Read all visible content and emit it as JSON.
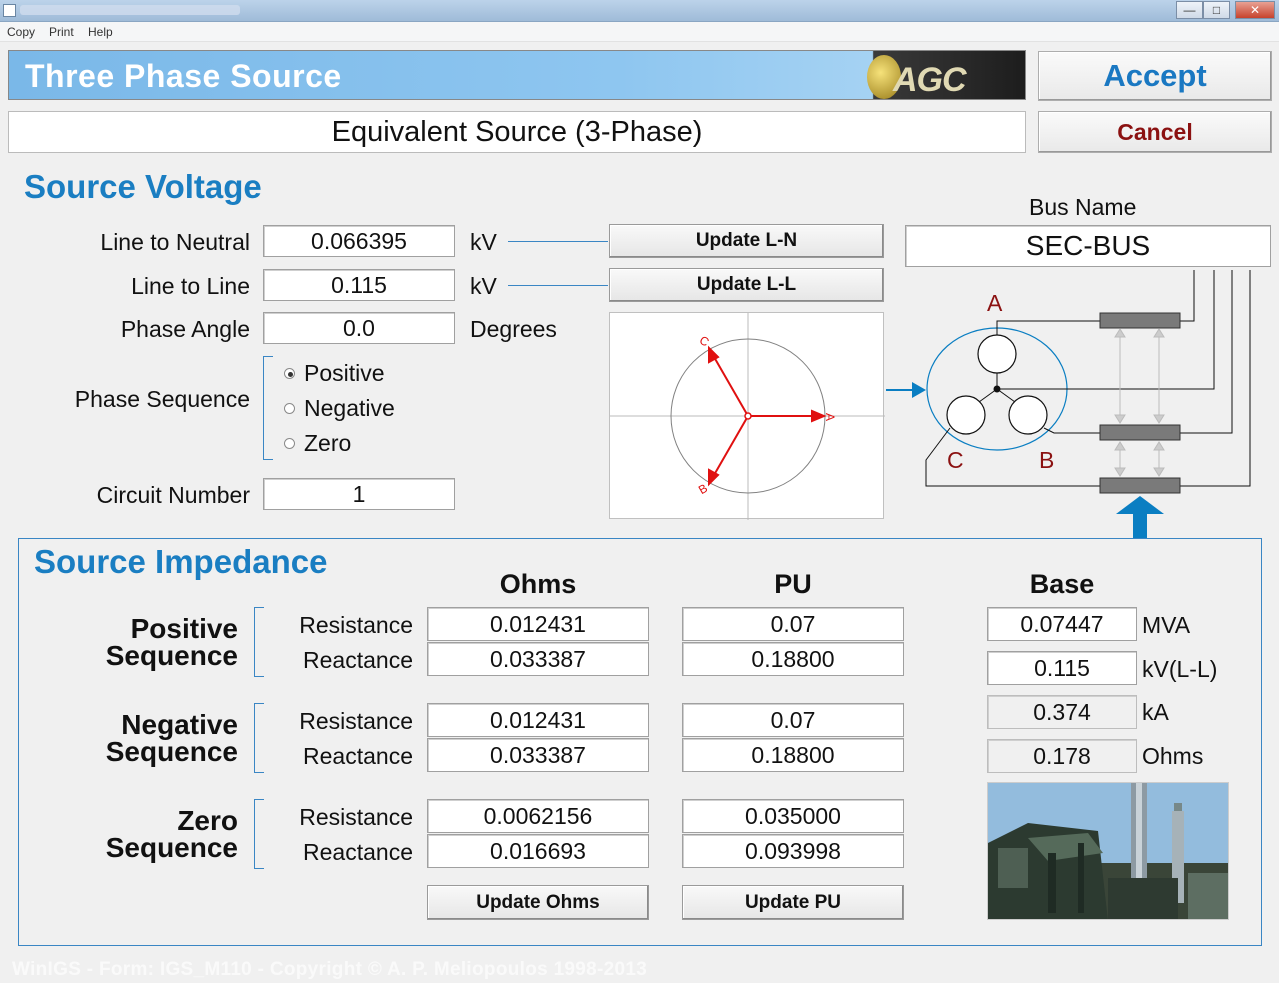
{
  "window": {
    "minimize": "—",
    "maximize": "□",
    "close": "✕"
  },
  "menu": {
    "items": [
      "Copy",
      "Print",
      "Help"
    ]
  },
  "header": {
    "title": "Three Phase Source",
    "logo_text": "AGC",
    "subtitle": "Equivalent Source (3-Phase)",
    "accept_label": "Accept",
    "cancel_label": "Cancel"
  },
  "source_voltage": {
    "title": "Source Voltage",
    "line_to_neutral": {
      "label": "Line to Neutral",
      "value": "0.066395",
      "unit": "kV"
    },
    "line_to_line": {
      "label": "Line to Line",
      "value": "0.115",
      "unit": "kV"
    },
    "phase_angle": {
      "label": "Phase Angle",
      "value": "0.0",
      "unit": "Degrees"
    },
    "phase_sequence": {
      "label": "Phase Sequence",
      "options": [
        "Positive",
        "Negative",
        "Zero"
      ],
      "selected": "Positive"
    },
    "circuit_number": {
      "label": "Circuit Number",
      "value": "1"
    },
    "update_ln_label": "Update L-N",
    "update_ll_label": "Update L-L"
  },
  "phasor": {
    "labels": [
      "A",
      "B",
      "C"
    ],
    "colors": {
      "phasor": "#e01010",
      "circle": "#808080"
    }
  },
  "bus": {
    "label": "Bus Name",
    "value": "SEC-BUS"
  },
  "schematic": {
    "phase_labels": [
      "A",
      "B",
      "C"
    ],
    "colors": {
      "label": "#8b1111",
      "accent": "#0a7ec2"
    }
  },
  "source_impedance": {
    "title": "Source Impedance",
    "columns": [
      "Ohms",
      "PU",
      "Base"
    ],
    "sequences": [
      {
        "name_line1": "Positive",
        "name_line2": "Sequence",
        "rows": [
          {
            "label": "Resistance",
            "ohms": "0.012431",
            "pu": "0.07"
          },
          {
            "label": "Reactance",
            "ohms": "0.033387",
            "pu": "0.18800"
          }
        ]
      },
      {
        "name_line1": "Negative",
        "name_line2": "Sequence",
        "rows": [
          {
            "label": "Resistance",
            "ohms": "0.012431",
            "pu": "0.07"
          },
          {
            "label": "Reactance",
            "ohms": "0.033387",
            "pu": "0.18800"
          }
        ]
      },
      {
        "name_line1": "Zero",
        "name_line2": "Sequence",
        "rows": [
          {
            "label": "Resistance",
            "ohms": "0.0062156",
            "pu": "0.035000"
          },
          {
            "label": "Reactance",
            "ohms": "0.016693",
            "pu": "0.093998"
          }
        ]
      }
    ],
    "base": [
      {
        "value": "0.07447",
        "unit": "MVA"
      },
      {
        "value": "0.115",
        "unit": "kV(L-L)"
      },
      {
        "value": "0.374",
        "unit": "kA"
      },
      {
        "value": "0.178",
        "unit": "Ohms"
      }
    ],
    "update_ohms_label": "Update Ohms",
    "update_pu_label": "Update PU"
  },
  "footer": {
    "text": "WinIGS - Form: IGS_M110 - Copyright © A. P. Meliopoulos 1998-2013"
  },
  "theme": {
    "accent": "#1a7ec2",
    "cancel": "#8b1111",
    "header_blue": "#7ab8e8"
  }
}
